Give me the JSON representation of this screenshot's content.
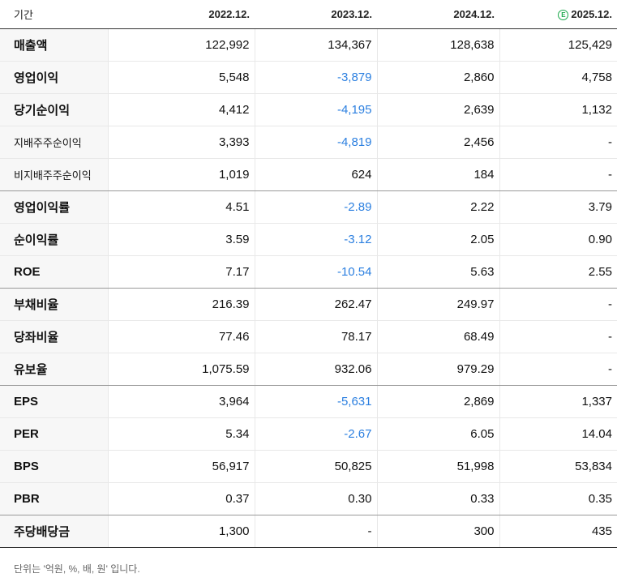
{
  "header": {
    "label": "기간",
    "periods": [
      "2022.12.",
      "2023.12.",
      "2024.12.",
      "2025.12."
    ],
    "estimate_icon": "E"
  },
  "colors": {
    "negative": "#2b7fe0",
    "estimate": "#1aa84a"
  },
  "rows": [
    {
      "label": "매출액",
      "values": [
        "122,992",
        "134,367",
        "128,638",
        "125,429"
      ]
    },
    {
      "label": "영업이익",
      "values": [
        "5,548",
        "-3,879",
        "2,860",
        "4,758"
      ]
    },
    {
      "label": "당기순이익",
      "values": [
        "4,412",
        "-4,195",
        "2,639",
        "1,132"
      ]
    },
    {
      "label": "지배주주순이익",
      "values": [
        "3,393",
        "-4,819",
        "2,456",
        "-"
      ]
    },
    {
      "label": "비지배주주순이익",
      "values": [
        "1,019",
        "624",
        "184",
        "-"
      ]
    },
    {
      "label": "영업이익률",
      "values": [
        "4.51",
        "-2.89",
        "2.22",
        "3.79"
      ]
    },
    {
      "label": "순이익률",
      "values": [
        "3.59",
        "-3.12",
        "2.05",
        "0.90"
      ]
    },
    {
      "label": "ROE",
      "values": [
        "7.17",
        "-10.54",
        "5.63",
        "2.55"
      ]
    },
    {
      "label": "부채비율",
      "values": [
        "216.39",
        "262.47",
        "249.97",
        "-"
      ]
    },
    {
      "label": "당좌비율",
      "values": [
        "77.46",
        "78.17",
        "68.49",
        "-"
      ]
    },
    {
      "label": "유보율",
      "values": [
        "1,075.59",
        "932.06",
        "979.29",
        "-"
      ]
    },
    {
      "label": "EPS",
      "values": [
        "3,964",
        "-5,631",
        "2,869",
        "1,337"
      ]
    },
    {
      "label": "PER",
      "values": [
        "5.34",
        "-2.67",
        "6.05",
        "14.04"
      ]
    },
    {
      "label": "BPS",
      "values": [
        "56,917",
        "50,825",
        "51,998",
        "53,834"
      ]
    },
    {
      "label": "PBR",
      "values": [
        "0.37",
        "0.30",
        "0.33",
        "0.35"
      ]
    },
    {
      "label": "주당배당금",
      "values": [
        "1,300",
        "-",
        "300",
        "435"
      ]
    }
  ],
  "footnote": "단위는 '억원, %, 배, 원' 입니다."
}
